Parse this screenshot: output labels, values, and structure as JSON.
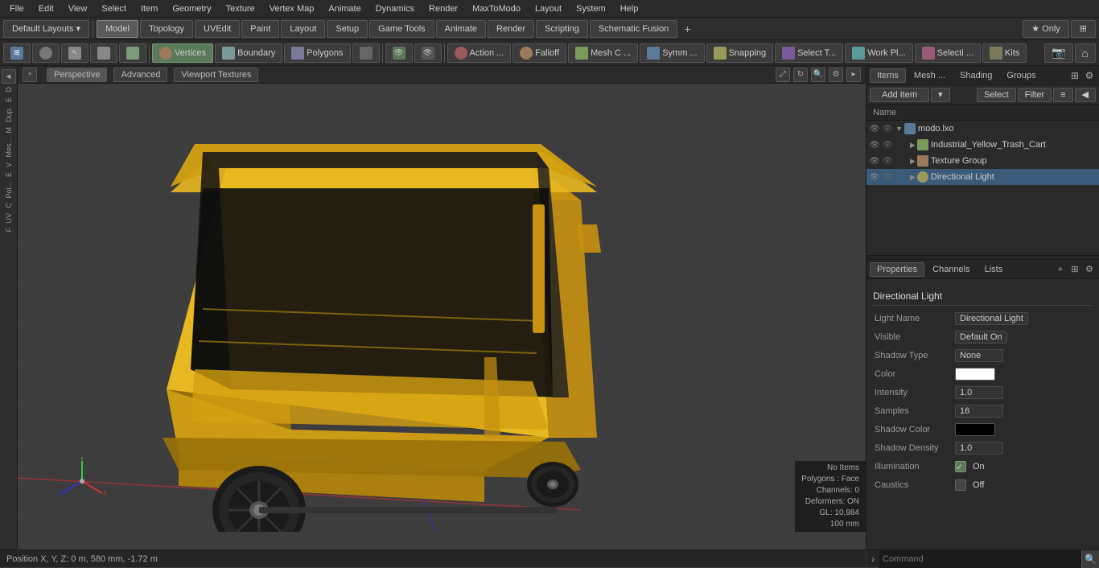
{
  "menubar": {
    "items": [
      "File",
      "Edit",
      "View",
      "Select",
      "Item",
      "Geometry",
      "Texture",
      "Vertex Map",
      "Animate",
      "Dynamics",
      "Render",
      "MaxToModo",
      "Layout",
      "System",
      "Help"
    ]
  },
  "toolbar1": {
    "layouts_label": "Default Layouts ▾",
    "tabs": [
      "Model",
      "Topology",
      "UVEdit",
      "Paint",
      "Layout",
      "Setup",
      "Game Tools",
      "Animate",
      "Render",
      "Scripting",
      "Schematic Fusion"
    ],
    "active_tab": "Model",
    "plus_icon": "+"
  },
  "toolbar2": {
    "buttons": [
      {
        "label": "",
        "icon": "grid",
        "type": "icon-only"
      },
      {
        "label": "",
        "icon": "sphere",
        "type": "icon-only"
      },
      {
        "label": "",
        "icon": "cursor",
        "type": "icon-only"
      },
      {
        "label": "",
        "icon": "box",
        "type": "icon-only"
      },
      {
        "label": "",
        "icon": "transform",
        "type": "icon-only"
      },
      {
        "label": "Vertices",
        "icon": "vertex",
        "type": "label"
      },
      {
        "label": "Boundary",
        "icon": "boundary",
        "type": "label"
      },
      {
        "label": "Polygons",
        "icon": "polygon",
        "type": "label"
      },
      {
        "label": "",
        "icon": "square",
        "type": "icon-only"
      },
      {
        "label": "",
        "icon": "eye",
        "type": "icon-only"
      },
      {
        "label": "",
        "icon": "eye2",
        "type": "icon-only"
      },
      {
        "label": "Action ...",
        "icon": "action",
        "type": "label"
      },
      {
        "label": "Falloff",
        "icon": "falloff",
        "type": "label"
      },
      {
        "label": "Mesh C ...",
        "icon": "mesh",
        "type": "label"
      },
      {
        "label": "Symm ...",
        "icon": "symm",
        "type": "label"
      },
      {
        "label": "Snapping",
        "icon": "snap",
        "type": "label"
      },
      {
        "label": "Select T...",
        "icon": "select",
        "type": "label"
      },
      {
        "label": "Work Pl...",
        "icon": "workplane",
        "type": "label"
      },
      {
        "label": "Selecti ...",
        "icon": "selection",
        "type": "label"
      },
      {
        "label": "Kits",
        "icon": "kits",
        "type": "label"
      }
    ],
    "right_icons": [
      "camera",
      "home"
    ]
  },
  "viewport": {
    "tabs": [
      "Perspective",
      "Advanced",
      "Viewport Textures"
    ],
    "active_tab": "Perspective",
    "status": {
      "no_items": "No Items",
      "polygons": "Polygons : Face",
      "channels": "Channels: 0",
      "deformers": "Deformers: ON",
      "gl": "GL: 10,984",
      "scale": "100 mm"
    }
  },
  "left_sidebar": {
    "labels": [
      "D",
      "E",
      "Dup.",
      "M",
      "Mes...",
      "V",
      "E",
      "Pol...",
      "C",
      "UV",
      "F"
    ]
  },
  "right_panel": {
    "tabs": [
      "Items",
      "Mesh ...",
      "Shading",
      "Groups"
    ],
    "active_tab": "Items",
    "toolbar": {
      "add_item": "Add Item",
      "dropdown_icon": "▾",
      "select": "Select",
      "filter": "Filter"
    },
    "column_header": "Name",
    "items": [
      {
        "id": "root",
        "name": "modo.lxo",
        "icon": "scene",
        "level": 0,
        "expanded": true,
        "eye": true
      },
      {
        "id": "mesh",
        "name": "Industrial_Yellow_Trash_Cart",
        "icon": "mesh",
        "level": 1,
        "expanded": false,
        "eye": true
      },
      {
        "id": "texture",
        "name": "Texture Group",
        "icon": "texture",
        "level": 1,
        "expanded": false,
        "eye": true
      },
      {
        "id": "light",
        "name": "Directional Light",
        "icon": "light",
        "level": 1,
        "expanded": false,
        "eye": true
      }
    ]
  },
  "properties_panel": {
    "tabs": [
      "Properties",
      "Channels",
      "Lists"
    ],
    "active_tab": "Properties",
    "add_icon": "+",
    "title": "Directional Light",
    "properties": [
      {
        "label": "Light Name",
        "value": "Directional Light"
      },
      {
        "label": "Visible",
        "value": "Default On"
      },
      {
        "label": "Shadow Type",
        "value": "None"
      },
      {
        "label": "Color",
        "value": "color",
        "color": "#ffffff"
      },
      {
        "label": "Intensity",
        "value": "1.0"
      },
      {
        "label": "Samples",
        "value": "16"
      },
      {
        "label": "Shadow Color",
        "value": "color",
        "color": "#000000"
      },
      {
        "label": "Shadow Density",
        "value": "1.0"
      },
      {
        "label": "Illumination",
        "value": "On"
      },
      {
        "label": "Caustics",
        "value": "Off"
      }
    ]
  },
  "status_bar": {
    "position": "Position X, Y, Z:  0 m, 580 mm, -1.72 m",
    "command_placeholder": "Command"
  }
}
